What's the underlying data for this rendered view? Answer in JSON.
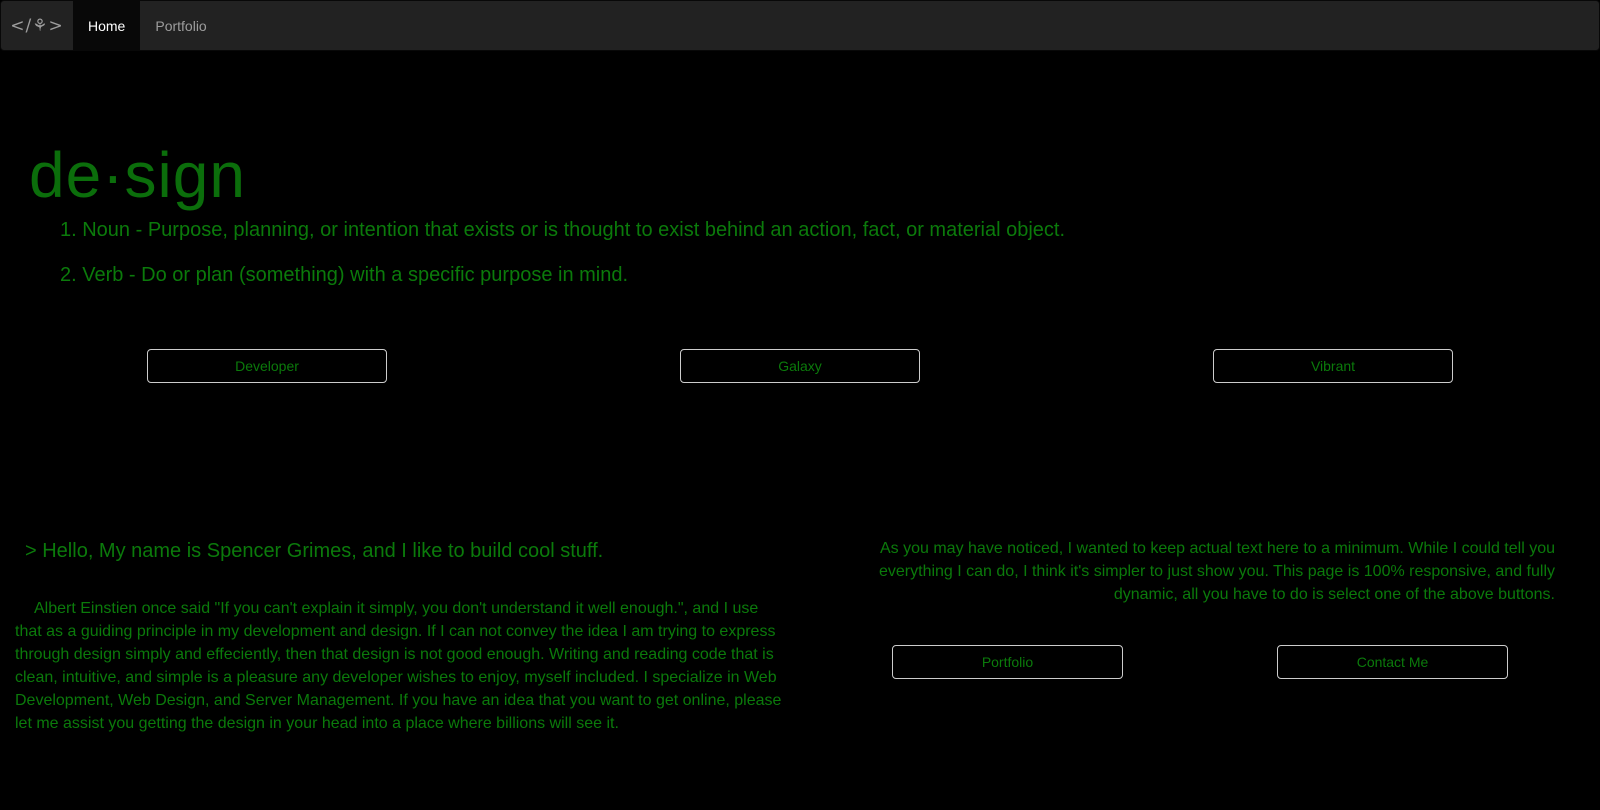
{
  "navbar": {
    "brand": "</⚘>",
    "items": [
      {
        "label": "Home"
      },
      {
        "label": "Portfolio"
      }
    ]
  },
  "hero": {
    "title": "de·sign",
    "definitions": [
      "1. Noun - Purpose, planning, or intention that exists or is thought to exist behind an action, fact, or material object.",
      "2. Verb - Do or plan (something) with a specific purpose in mind."
    ]
  },
  "theme_buttons": [
    {
      "label": "Developer"
    },
    {
      "label": "Galaxy"
    },
    {
      "label": "Vibrant"
    }
  ],
  "intro": {
    "hello": "> Hello, My name is Spencer Grimes, and I like to build cool stuff.",
    "about": "Albert Einstien once said \"If you can't explain it simply, you don't understand it well enough.\", and I use that as a guiding principle in my development and design. If I can not convey the idea I am trying to express through design simply and effeciently, then that design is not good enough. Writing and reading code that is clean, intuitive, and simple is a pleasure any developer wishes to enjoy, myself included. I specialize in Web Development, Web Design, and Server Management. If you have an idea that you want to get online, please let me assist you getting the design in your head into a place where billions will see it."
  },
  "notice": {
    "text": "As you may have noticed, I wanted to keep actual text here to a minimum. While I could tell you everything I can do, I think it's simpler to just show you. This page is 100% responsive, and fully dynamic, all you have to do is select one of the above buttons."
  },
  "action_buttons": {
    "portfolio": "Portfolio",
    "contact": "Contact Me"
  },
  "colors": {
    "background": "#000000",
    "navbar": "#222222",
    "text_green": "#0b7a0b",
    "button_border": "#cccccc"
  }
}
